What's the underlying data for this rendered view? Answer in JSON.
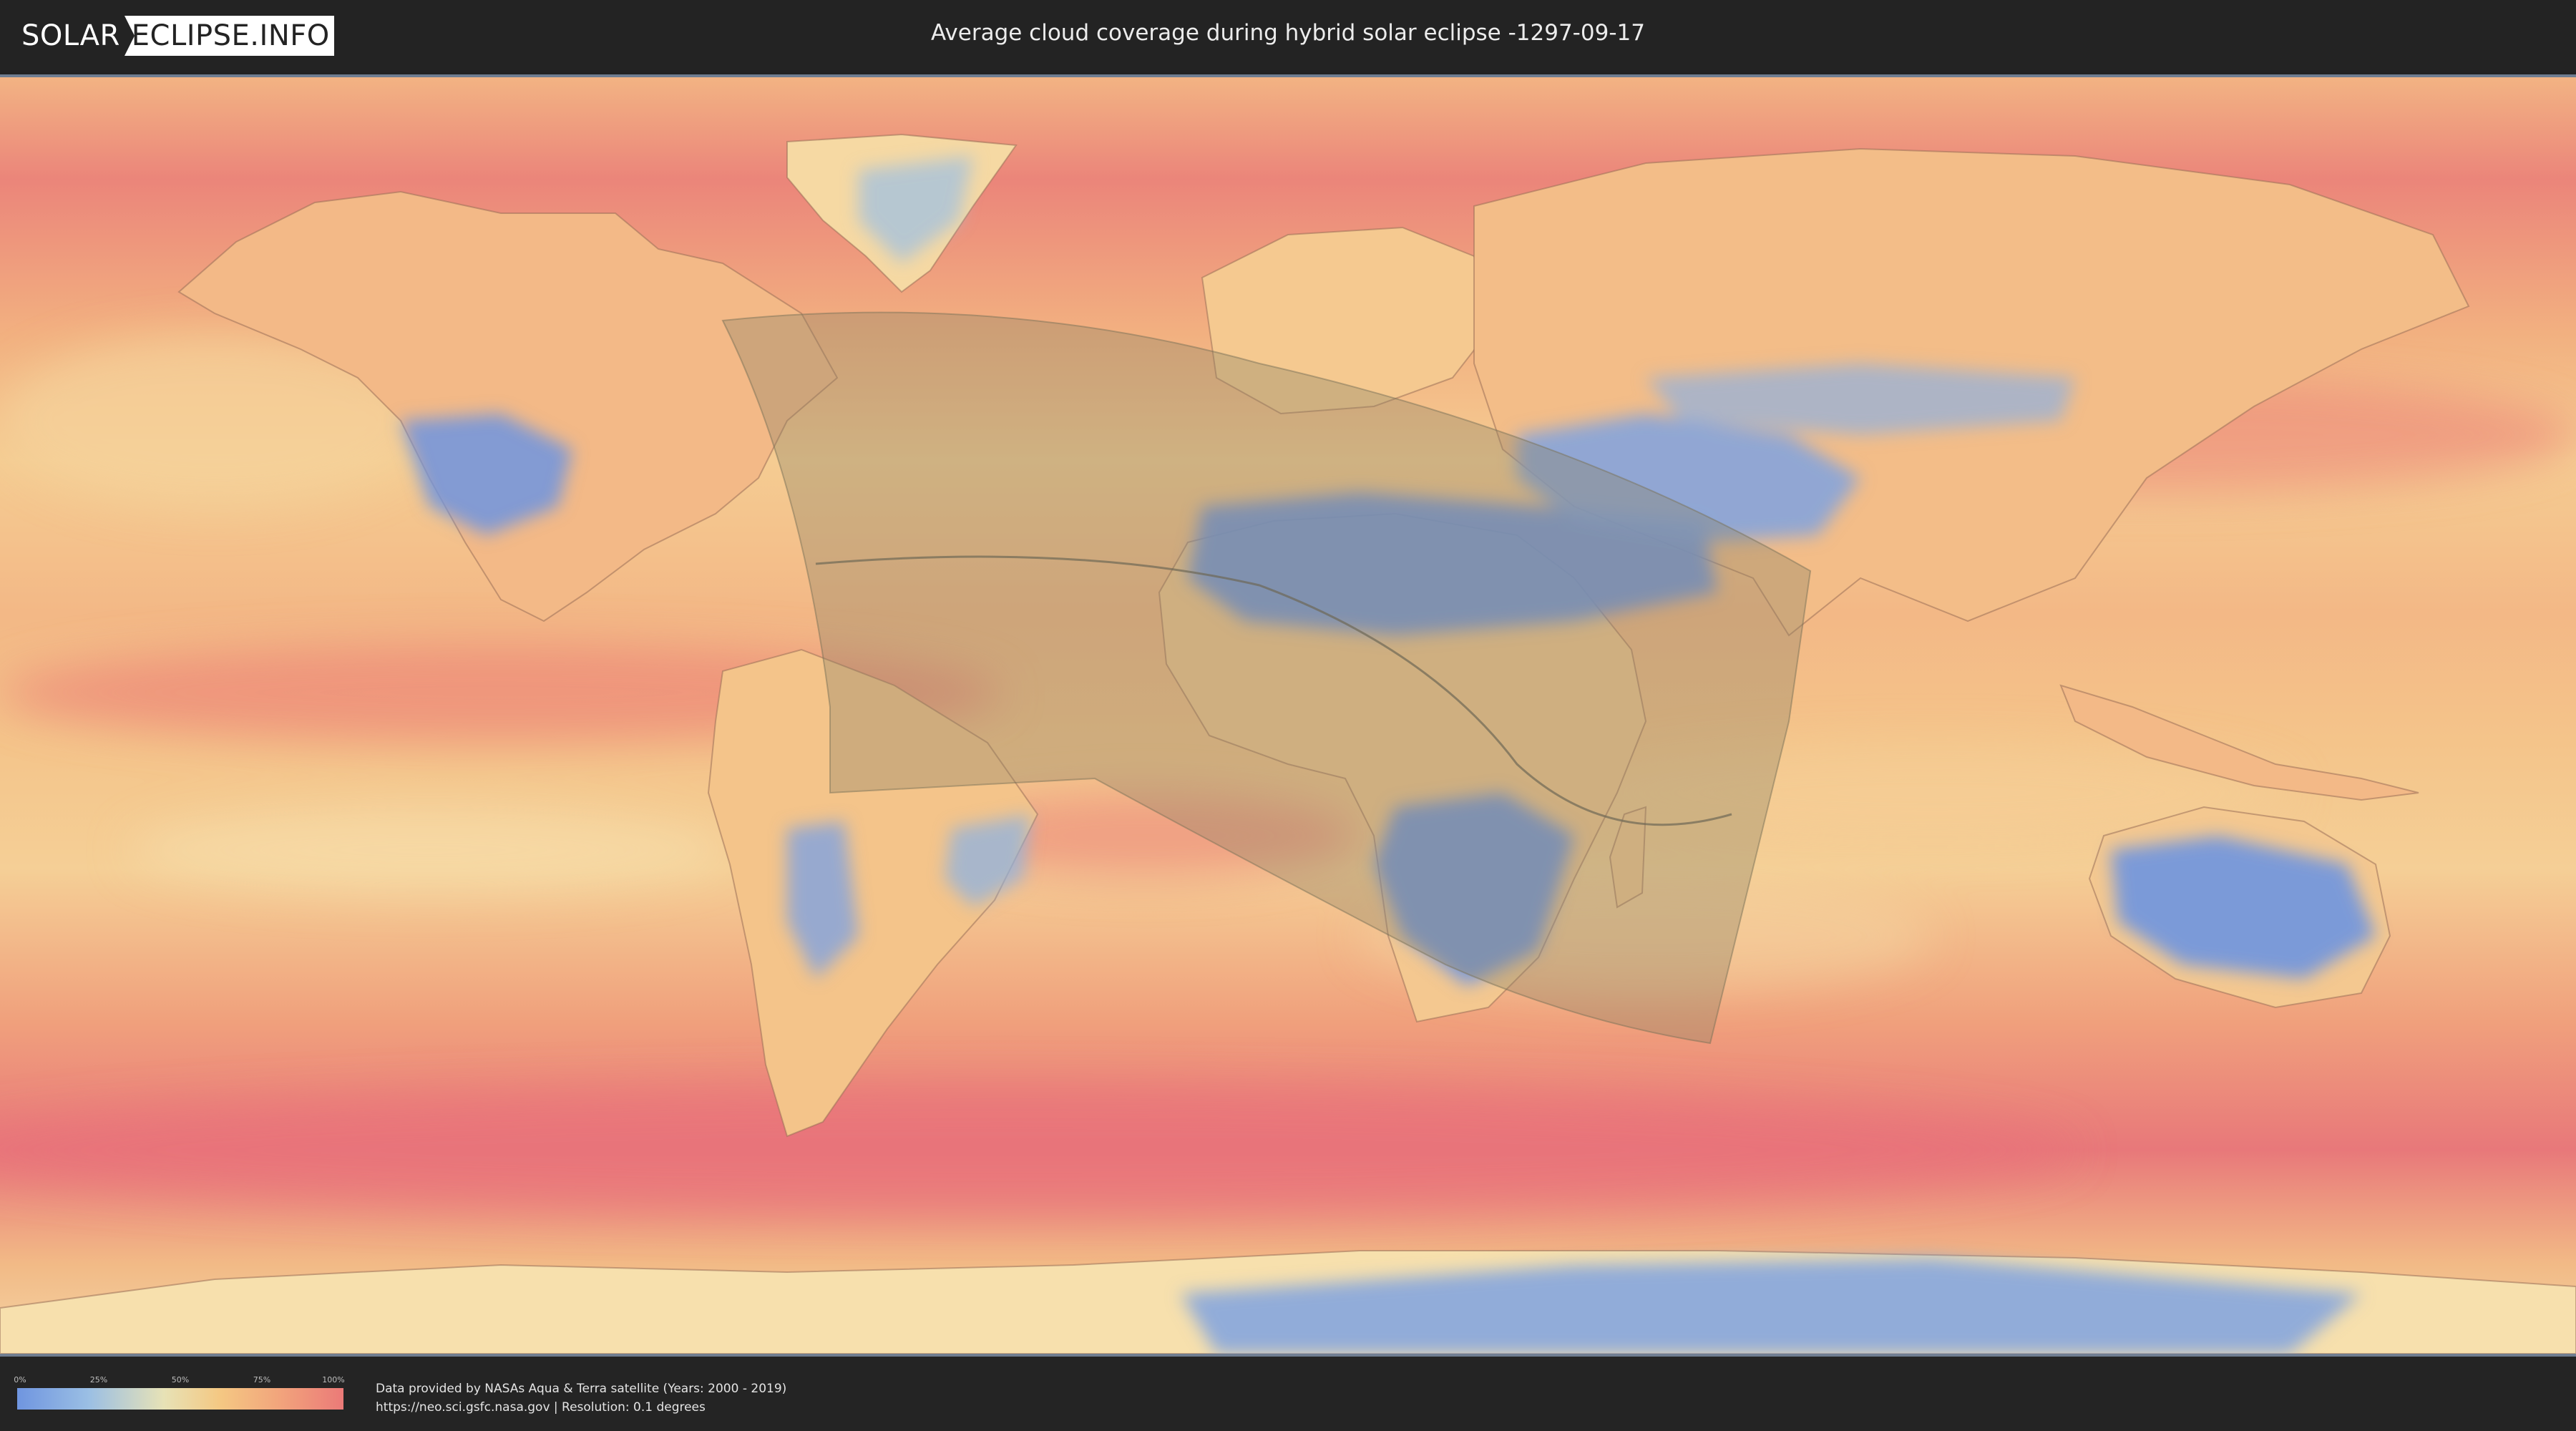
{
  "header": {
    "logo_left": "SOLAR",
    "logo_right": "ECLIPSE.INFO",
    "title": "Average cloud coverage during hybrid solar eclipse -1297-09-17"
  },
  "legend": {
    "ticks": [
      "0%",
      "25%",
      "50%",
      "75%",
      "100%"
    ],
    "colors": [
      "#6f95e0",
      "#9bbfe4",
      "#e7e2b6",
      "#f4c883",
      "#f2a57c",
      "#eb7a78"
    ]
  },
  "footer": {
    "credit_line1": "Data provided by NASAs Aqua & Terra satellite (Years: 2000 - 2019)",
    "credit_line2": "https://neo.sci.gsfc.nasa.gov | Resolution: 0.1 degrees"
  },
  "map": {
    "ocean_color": "#f0a47c",
    "eclipse_overlay_color": "#8a8263"
  }
}
